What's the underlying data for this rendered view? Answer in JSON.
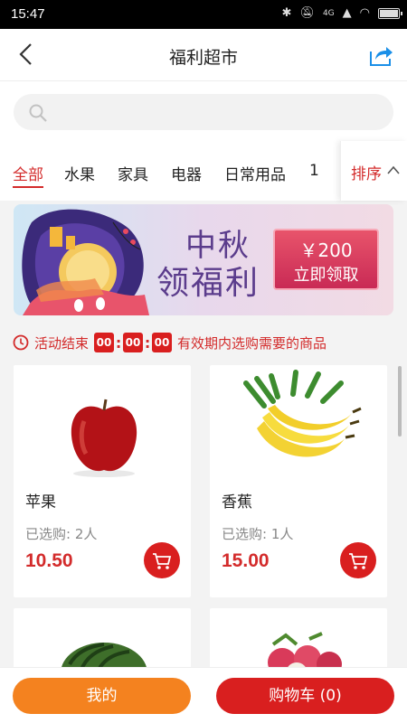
{
  "status_bar": {
    "time": "15:47",
    "network": "4G"
  },
  "header": {
    "title": "福利超市"
  },
  "search": {
    "placeholder": ""
  },
  "tabs": [
    {
      "label": "全部",
      "active": true
    },
    {
      "label": "水果",
      "active": false
    },
    {
      "label": "家具",
      "active": false
    },
    {
      "label": "电器",
      "active": false
    },
    {
      "label": "日常用品",
      "active": false
    },
    {
      "label": "1",
      "active": false
    }
  ],
  "sort": {
    "label": "排序"
  },
  "banner": {
    "title_line1": "中秋",
    "title_line2": "领福利",
    "coupon_amount": "￥200",
    "coupon_cta": "立即领取"
  },
  "activity": {
    "label": "活动结束",
    "hours": "00",
    "minutes": "00",
    "seconds": "00",
    "note": "有效期内选购需要的商品"
  },
  "products": [
    {
      "name": "苹果",
      "sold": "已选购: 2人",
      "price": "10.50",
      "image": "apple"
    },
    {
      "name": "香蕉",
      "sold": "已选购: 1人",
      "price": "15.00",
      "image": "banana"
    },
    {
      "name": "",
      "sold": "",
      "price": "",
      "image": "watermelon"
    },
    {
      "name": "",
      "sold": "",
      "price": "",
      "image": "lychee"
    }
  ],
  "bottom": {
    "mine_label": "我的",
    "cart_label": "购物车  (0)"
  },
  "colors": {
    "accent": "#d91f1f",
    "orange": "#f4821f",
    "banner_text": "#5b3c8c"
  },
  "icons": [
    "back-icon",
    "share-icon",
    "search-icon",
    "chevron-up-icon",
    "clock-icon",
    "cart-icon"
  ]
}
